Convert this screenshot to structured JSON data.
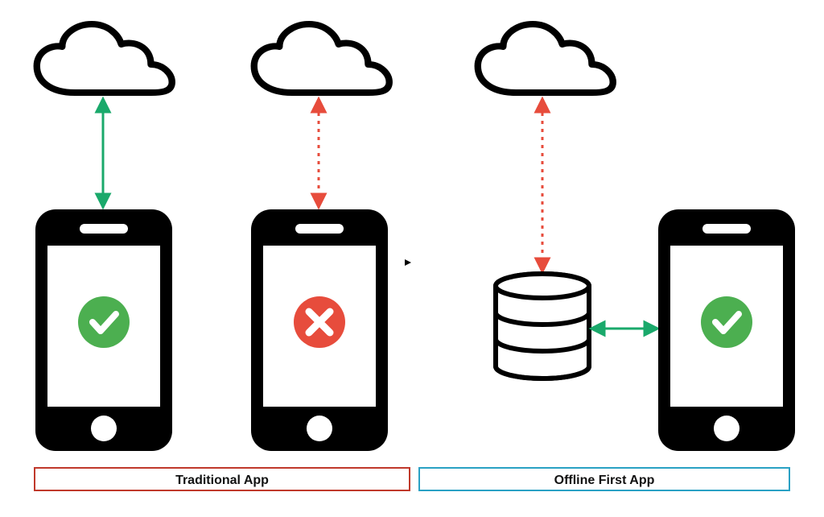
{
  "labels": {
    "traditional": "Traditional App",
    "offline": "Offline First App"
  },
  "colors": {
    "success_green": "#4caf50",
    "error_red": "#e74c3c",
    "dotted_red": "#e74c3c",
    "arrow_green": "#1aa96b",
    "label_red": "#c0392b",
    "label_blue": "#2aa1c4",
    "black": "#000000",
    "white": "#ffffff"
  },
  "icons": {
    "left_cloud": "cloud",
    "middle_cloud": "cloud",
    "right_cloud": "cloud",
    "left_phone_status": "check",
    "middle_phone_status": "cross",
    "right_phone_status": "check",
    "database": "database",
    "phone": "smartphone"
  },
  "connections": {
    "left": {
      "style": "solid",
      "color": "#1aa96b",
      "description": "online-connection"
    },
    "middle": {
      "style": "dotted",
      "color": "#e74c3c",
      "description": "broken-connection"
    },
    "right_cloud_db": {
      "style": "dotted",
      "color": "#e74c3c",
      "description": "intermittent-sync"
    },
    "right_db_phone": {
      "style": "solid",
      "color": "#1aa96b",
      "description": "local-db-connection"
    }
  }
}
